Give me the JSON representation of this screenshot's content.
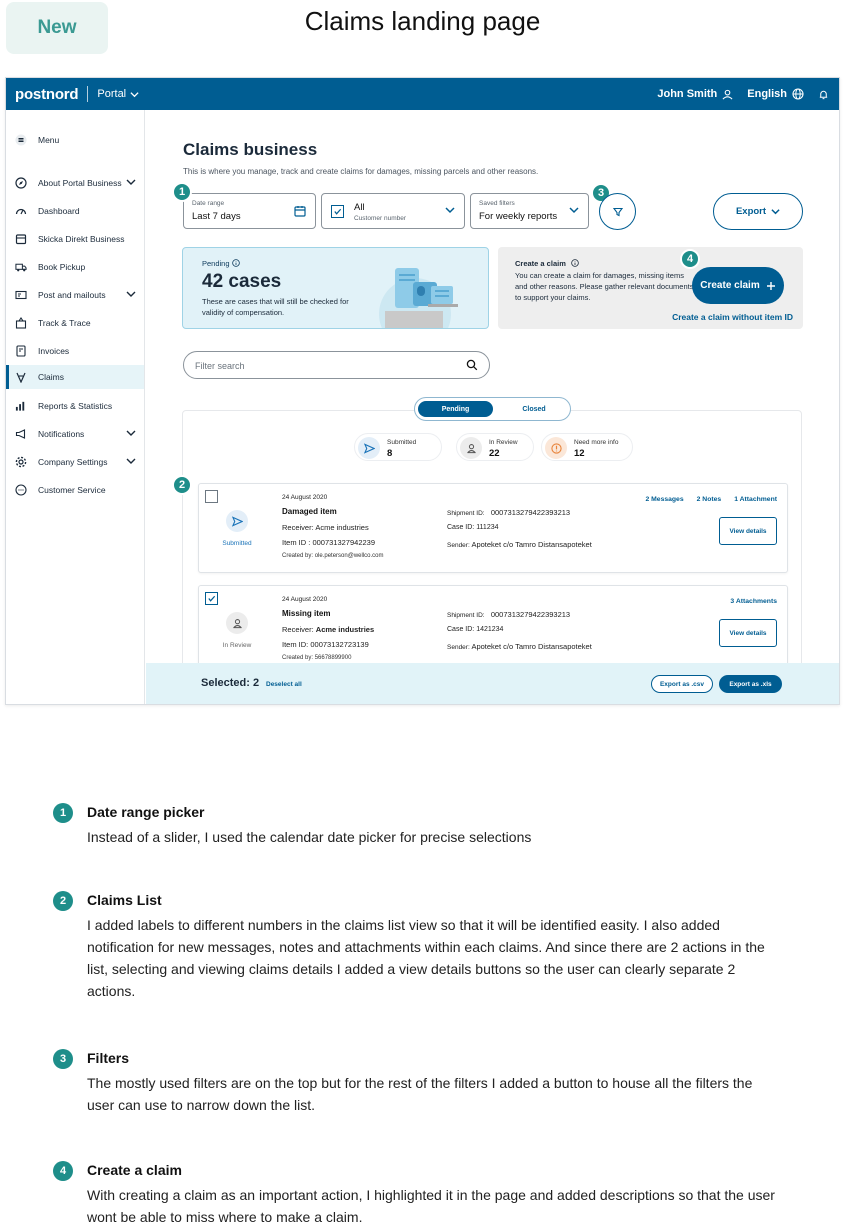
{
  "header": {
    "badge": "New",
    "heading": "Claims landing page"
  },
  "topbar": {
    "logo": "postnord",
    "portal_label": "Portal",
    "user_name": "John Smith",
    "language": "English"
  },
  "sidebar": {
    "items": [
      {
        "label": "Menu",
        "icon": "menu-icon"
      },
      {
        "label": "About Portal Business",
        "icon": "compass-icon"
      },
      {
        "label": "Dashboard",
        "icon": "gauge-icon"
      },
      {
        "label": "Skicka Direkt Business",
        "icon": "box-icon"
      },
      {
        "label": "Book Pickup",
        "icon": "truck-icon"
      },
      {
        "label": "Post and mailouts",
        "icon": "mail-icon"
      },
      {
        "label": "Track & Trace",
        "icon": "package-icon"
      },
      {
        "label": "Invoices",
        "icon": "invoice-icon"
      },
      {
        "label": "Claims",
        "icon": "claims-icon"
      },
      {
        "label": "Reports & Statistics",
        "icon": "chart-icon"
      },
      {
        "label": "Notifications",
        "icon": "megaphone-icon"
      },
      {
        "label": "Company Settings",
        "icon": "gear-icon"
      },
      {
        "label": "Customer Service",
        "icon": "chat-icon"
      }
    ]
  },
  "main": {
    "title": "Claims business",
    "subtitle": "This is where you manage, track and create claims for damages, missing parcels and other reasons."
  },
  "filters": {
    "date_label": "Date range",
    "date_value": "Last 7 days",
    "customer_value": "All",
    "customer_label": "Customer number",
    "saved_label": "Saved filters",
    "saved_value": "For weekly reports",
    "export_label": "Export"
  },
  "markers": {
    "one": "1",
    "two": "2",
    "three": "3",
    "four": "4"
  },
  "pending_card": {
    "label": "Pending",
    "value": "42 cases",
    "description": "These are cases that will still be checked for validity of compensation."
  },
  "create_card": {
    "title": "Create a claim",
    "description": "You can create a claim for damages, missing items and other reasons. Please gather relevant documents to support your claims.",
    "button": "Create claim",
    "link": "Create a claim without item ID"
  },
  "search": {
    "placeholder": "Filter search"
  },
  "tabs": {
    "active": "Pending",
    "inactive": "Closed"
  },
  "stats": [
    {
      "label": "Submitted",
      "value": "8"
    },
    {
      "label": "In Review",
      "value": "22"
    },
    {
      "label": "Need more info",
      "value": "12"
    }
  ],
  "claims": [
    {
      "date": "24 August 2020",
      "type": "Damaged item",
      "receiver_label": "Receiver:",
      "receiver": "Acme industries",
      "item_label": "Item ID :",
      "item_id": "000731327942239",
      "created_label": "Created by:",
      "created_by": "ole.peterson@wellco.com",
      "shipment_label": "Shipment ID:",
      "shipment_id": "0007313279422393213",
      "case_label": "Case ID:",
      "case_id": "111234",
      "sender_label": "Sender:",
      "sender": "Apoteket c/o Tamro Distansapoteket",
      "status": "Submitted",
      "messages": "2 Messages",
      "notes": "2 Notes",
      "attachments": "1 Attachment",
      "view": "View details"
    },
    {
      "date": "24 August 2020",
      "type": "Missing item",
      "receiver_label": "Receiver:",
      "receiver": "Acme industries",
      "item_label": "Item ID:",
      "item_id": "00073132723139",
      "created_label": "Created by:",
      "created_by": "56678899900",
      "shipment_label": "Shipment ID:",
      "shipment_id": "0007313279422393213",
      "case_label": "Case ID:",
      "case_id": "1421234",
      "sender_label": "Sender:",
      "sender": "Apoteket c/o Tamro Distansapoteket",
      "status": "In Review",
      "attachments": "3 Attachments",
      "view": "View details"
    }
  ],
  "footer": {
    "selected": "Selected: 2",
    "deselect": "Deselect all",
    "export_csv": "Export as .csv",
    "export_xls": "Export as .xls"
  },
  "notes": [
    {
      "num": "1",
      "title": "Date range picker",
      "text": "Instead of a slider, I used the calendar date picker for precise selections"
    },
    {
      "num": "2",
      "title": "Claims List",
      "text": "I added labels to different numbers in the claims list view so that it will be identified easity. I also added notification for new messages, notes and attachments within each claims. And since there are 2 actions in the list, selecting and viewing claims details I added a view details buttons so the user can clearly separate 2 actions."
    },
    {
      "num": "3",
      "title": "Filters",
      "text": "The mostly used filters are on the top but for the rest of the filters I added a button to house all the filters the user can use to narrow down the list."
    },
    {
      "num": "4",
      "title": "Create a claim",
      "text": "With creating a claim as an important action, I highlighted it in the page and added descriptions so that the user wont be able to miss where to make a claim."
    }
  ],
  "colors": {
    "brand_blue": "#005d92",
    "teal_marker": "#1e8e8a",
    "pending_bg": "#e1f2f8",
    "submitted": "#1a73b8",
    "in_review": "#666666",
    "need_info": "#e8833a"
  }
}
